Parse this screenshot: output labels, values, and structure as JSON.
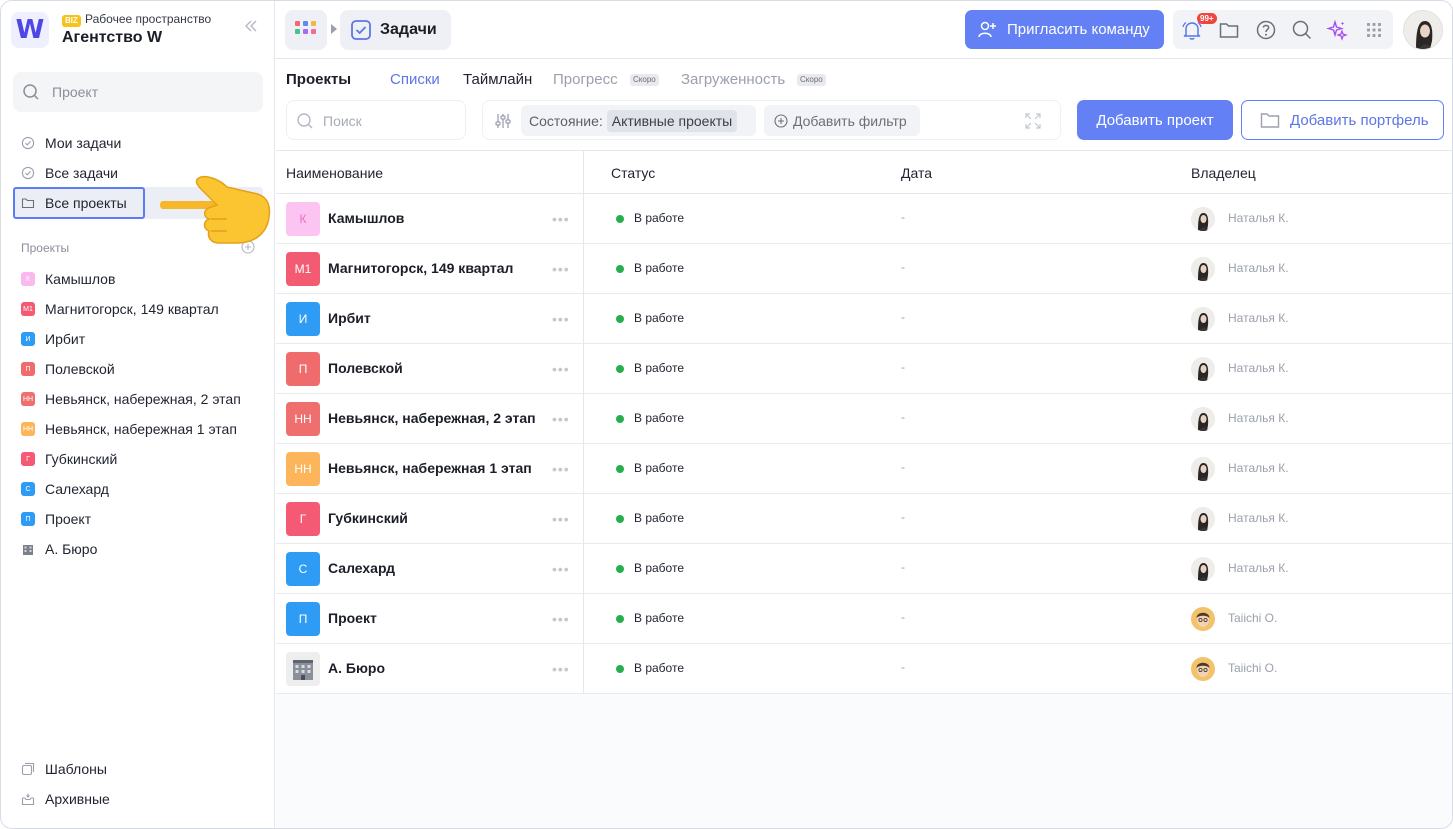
{
  "workspace": {
    "logo": "W",
    "badge": "BIZ",
    "subtitle": "Рабочее пространство",
    "name": "Агентство W",
    "collapse_icon": "chevrons-left-icon"
  },
  "sidebar": {
    "search_placeholder": "Проект",
    "nav": [
      {
        "label": "Мои задачи",
        "icon": "check-circle-icon"
      },
      {
        "label": "Все задачи",
        "icon": "check-circle-icon"
      },
      {
        "label": "Все проекты",
        "icon": "folder-icon",
        "active": true
      }
    ],
    "projects_title": "Проекты",
    "projects": [
      {
        "abbr": "К",
        "label": "Камышлов",
        "color": "#f9b9ee"
      },
      {
        "abbr": "М1",
        "label": "Магнитогорск, 149 квартал",
        "color": "#f35b72"
      },
      {
        "abbr": "И",
        "label": "Ирбит",
        "color": "#2e9cf4"
      },
      {
        "abbr": "П",
        "label": "Полевской",
        "color": "#f06b6b"
      },
      {
        "abbr": "НН",
        "label": "Невьянск, набережная, 2 этап",
        "color": "#ef6f6f"
      },
      {
        "abbr": "НН",
        "label": "Невьянск, набережная 1 этап",
        "color": "#fdb55b"
      },
      {
        "abbr": "Г",
        "label": "Губкинский",
        "color": "#f45a74"
      },
      {
        "abbr": "С",
        "label": "Салехард",
        "color": "#2e9cf4"
      },
      {
        "abbr": "П",
        "label": "Проект",
        "color": "#2e9cf4"
      },
      {
        "abbr": "",
        "label": "А. Бюро",
        "color": "#6f7480"
      }
    ],
    "footer": [
      {
        "label": "Шаблоны",
        "icon": "templates-icon"
      },
      {
        "label": "Архивные",
        "icon": "archive-icon"
      }
    ]
  },
  "topbar": {
    "breadcrumb": "Задачи",
    "invite_label": "Пригласить команду",
    "notifications_badge": "99+",
    "icons": [
      "bell-icon",
      "folder-icon",
      "help-icon",
      "search-icon",
      "sparkles-icon",
      "apps-grid-icon"
    ]
  },
  "header": {
    "title": "Проекты",
    "tabs": [
      {
        "label": "Списки",
        "active": true
      },
      {
        "label": "Таймлайн"
      },
      {
        "label": "Прогресс",
        "soon": "Скоро"
      },
      {
        "label": "Загруженность",
        "soon": "Скоро"
      }
    ],
    "search_placeholder": "Поиск",
    "filter_key": "Состояние:",
    "filter_value": "Активные проекты",
    "add_filter": "Добавить фильтр",
    "add_project": "Добавить проект",
    "add_portfolio": "Добавить портфель"
  },
  "table": {
    "columns": [
      "Наименование",
      "Статус",
      "Дата",
      "Владелец"
    ],
    "rows": [
      {
        "abbr": "К",
        "name": "Камышлов",
        "color": "#fcc4f1",
        "text_color": "#e86fcb",
        "status": "В работе",
        "date": "-",
        "owner": "Наталья К."
      },
      {
        "abbr": "М1",
        "name": "Магнитогорск, 149 квартал",
        "color": "#f35b72",
        "text_color": "#ffffff",
        "status": "В работе",
        "date": "-",
        "owner": "Наталья К."
      },
      {
        "abbr": "И",
        "name": "Ирбит",
        "color": "#2e9cf4",
        "text_color": "#ffffff",
        "status": "В работе",
        "date": "-",
        "owner": "Наталья К."
      },
      {
        "abbr": "П",
        "name": "Полевской",
        "color": "#f06b6b",
        "text_color": "#ffffff",
        "status": "В работе",
        "date": "-",
        "owner": "Наталья К."
      },
      {
        "abbr": "НН",
        "name": "Невьянск, набережная, 2 этап",
        "color": "#ef6f6f",
        "text_color": "#ffffff",
        "status": "В работе",
        "date": "-",
        "owner": "Наталья К."
      },
      {
        "abbr": "НН",
        "name": "Невьянск, набережная 1 этап",
        "color": "#fdb55b",
        "text_color": "#ffffff",
        "status": "В работе",
        "date": "-",
        "owner": "Наталья К."
      },
      {
        "abbr": "Г",
        "name": "Губкинский",
        "color": "#f45a74",
        "text_color": "#ffffff",
        "status": "В работе",
        "date": "-",
        "owner": "Наталья К."
      },
      {
        "abbr": "С",
        "name": "Салехард",
        "color": "#2e9cf4",
        "text_color": "#ffffff",
        "status": "В работе",
        "date": "-",
        "owner": "Наталья К."
      },
      {
        "abbr": "П",
        "name": "Проект",
        "color": "#2e9cf4",
        "text_color": "#ffffff",
        "status": "В работе",
        "date": "-",
        "owner": "Taiichi O."
      },
      {
        "abbr": "",
        "name": "А. Бюро",
        "color": "#eeeeee",
        "text_color": "#555555",
        "status": "В работе",
        "date": "-",
        "owner": "Taiichi O."
      }
    ]
  },
  "colors": {
    "accent": "#6381f5",
    "status_ok": "#27ae4f"
  }
}
